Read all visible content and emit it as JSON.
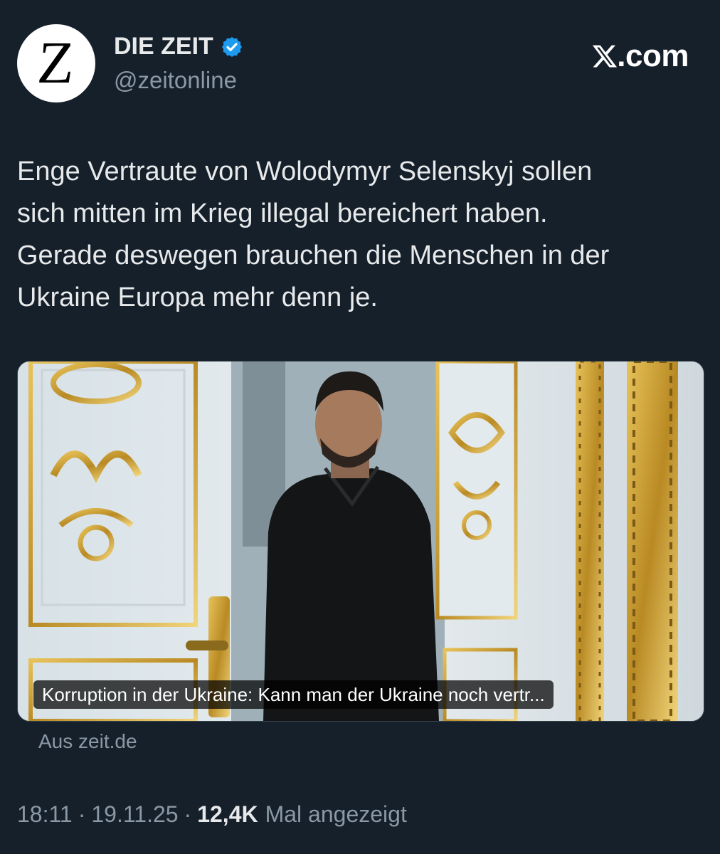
{
  "author": {
    "avatar_letter": "Z",
    "name": "DIE ZEIT",
    "handle": "@zeitonline",
    "verified": true
  },
  "brand": {
    "label": ".com",
    "icon": "x-logo-icon"
  },
  "tweet": {
    "text": "Enge Vertraute von Wolodymyr Selenskyj sollen\nsich mitten im Krieg illegal bereichert haben.\nGerade deswegen brauchen die Menschen in der\nUkraine Europa mehr denn je."
  },
  "card": {
    "caption": "Korruption in der Ukraine: Kann man der Ukraine noch vertr...",
    "source": "Aus zeit.de"
  },
  "meta": {
    "time": "18:11",
    "date": "19.11.25",
    "views_count": "12,4K",
    "views_label": "Mal angezeigt"
  },
  "colors": {
    "background": "#15202b",
    "text": "#e7e9ea",
    "muted": "#8b98a5",
    "verified": "#1d9bf0",
    "gold": "#c9a23a"
  }
}
